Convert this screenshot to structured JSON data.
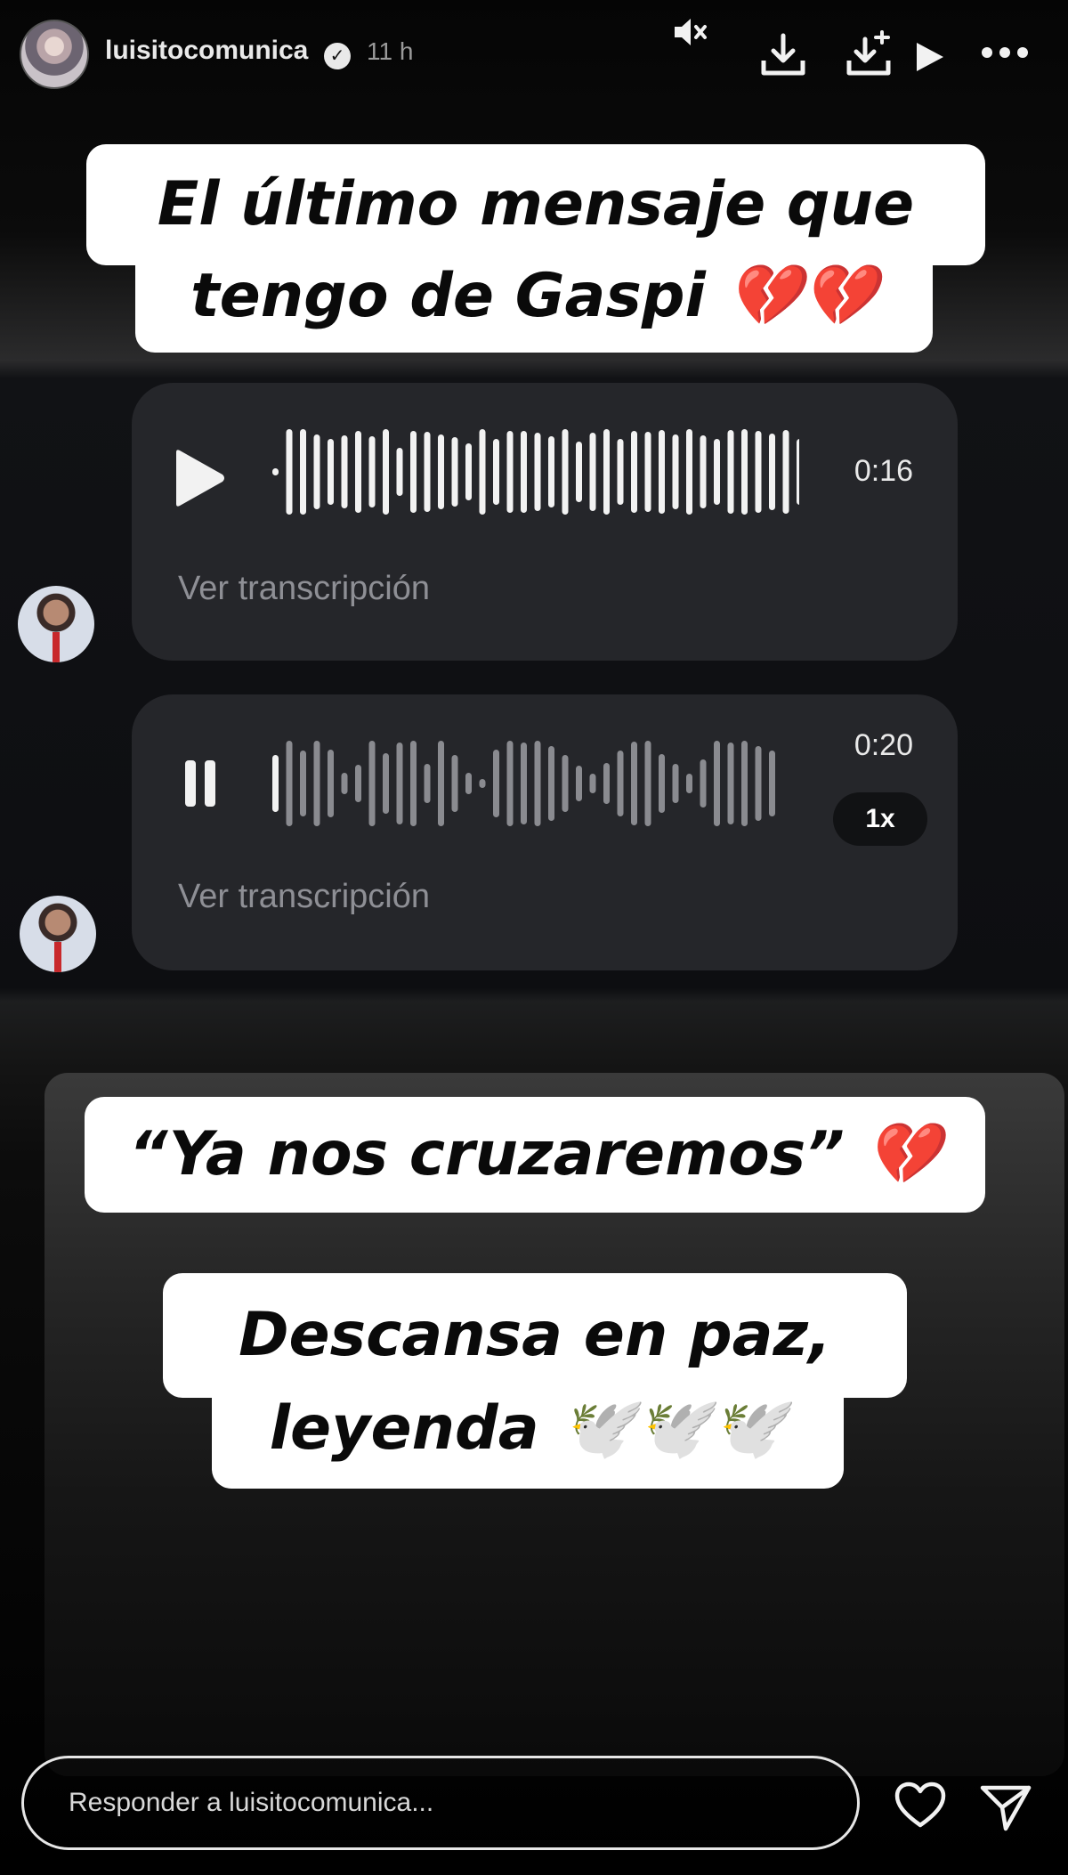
{
  "header": {
    "username": "luisitocomunica",
    "verified": "✓",
    "time": "11 h"
  },
  "captions": {
    "line1": "El último mensaje que",
    "line2": "tengo de Gaspi 💔💔",
    "quote": "“Ya nos cruzaremos” 💔",
    "rip1": "Descansa en paz,",
    "rip2": "leyenda 🕊️🕊️🕊️"
  },
  "voice_messages": [
    {
      "duration": "0:16",
      "transcript_link": "Ver transcripción",
      "state": "paused"
    },
    {
      "duration": "0:20",
      "transcript_link": "Ver transcripción",
      "state": "playing",
      "speed": "1x"
    }
  ],
  "footer": {
    "reply_placeholder": "Responder a luisitocomunica..."
  },
  "icons": [
    "muted-speaker-icon",
    "download-icon",
    "save-icon",
    "play-icon",
    "more-icon",
    "heart-icon",
    "send-icon"
  ]
}
